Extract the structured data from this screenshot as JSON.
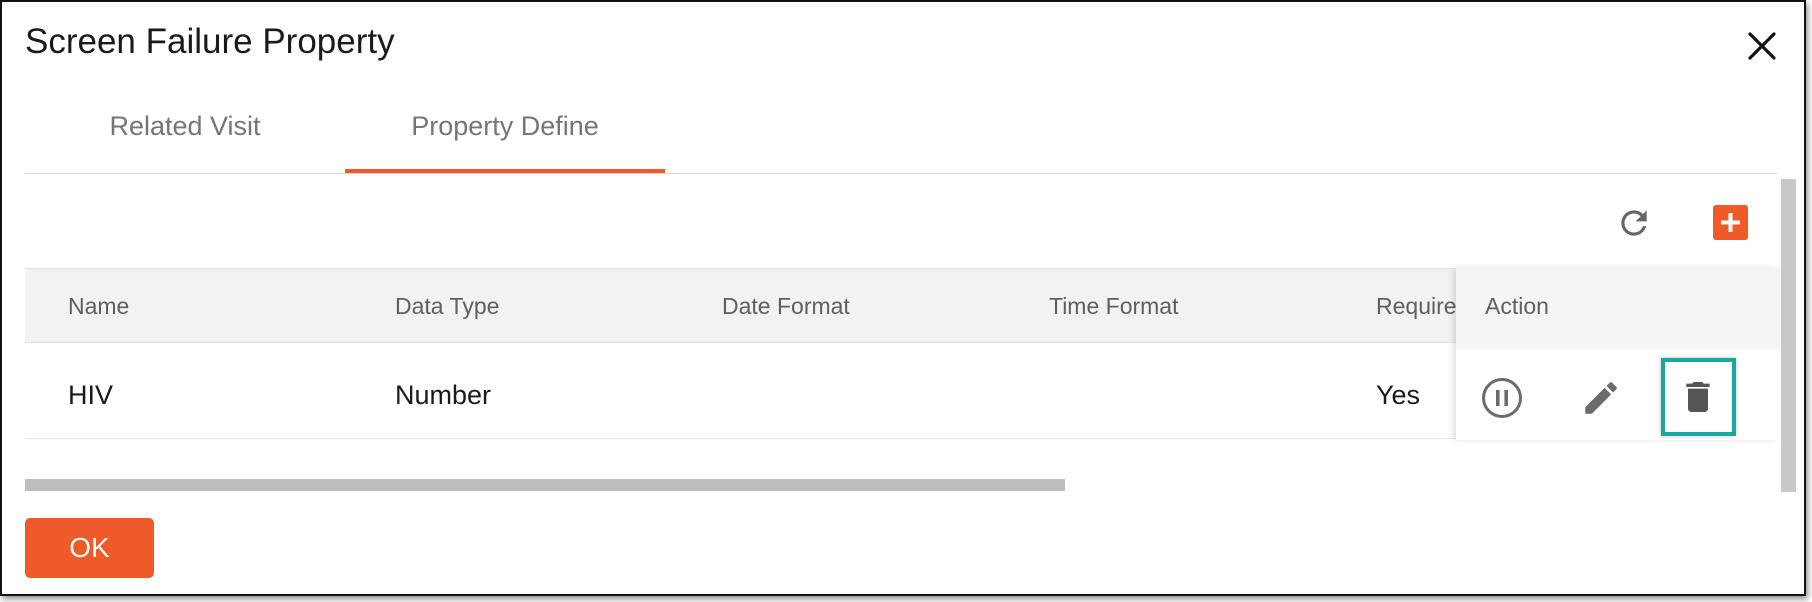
{
  "dialog": {
    "title": "Screen Failure Property"
  },
  "tabs": [
    {
      "label": "Related Visit",
      "active": false
    },
    {
      "label": "Property Define",
      "active": true
    }
  ],
  "toolbar": {
    "refresh_icon": "refresh-icon",
    "add_icon": "plus-icon"
  },
  "table": {
    "columns": [
      "Name",
      "Data Type",
      "Date Format",
      "Time Format",
      "Required",
      "Action"
    ],
    "rows": [
      {
        "name": "HIV",
        "data_type": "Number",
        "date_format": "",
        "time_format": "",
        "required": "Yes"
      }
    ],
    "row_actions": [
      "pause-icon",
      "edit-icon",
      "delete-icon"
    ]
  },
  "footer": {
    "ok_label": "OK"
  },
  "colors": {
    "accent": "#f05a28",
    "highlight": "#1aa89a"
  }
}
